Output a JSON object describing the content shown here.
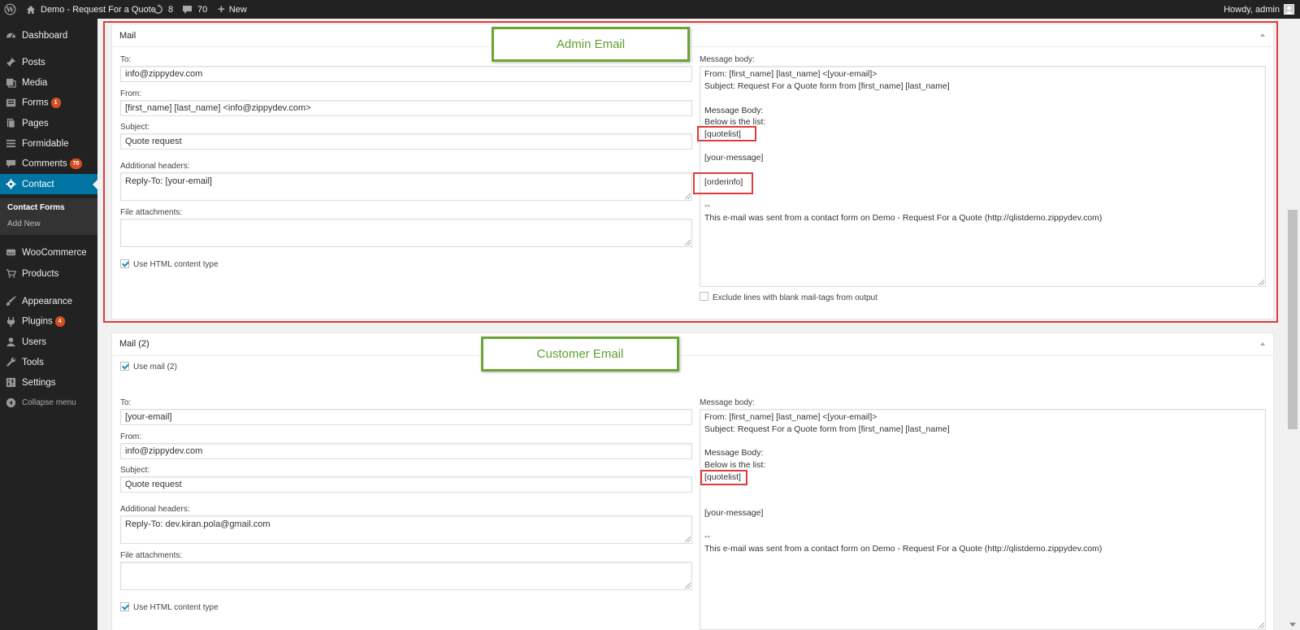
{
  "admin_bar": {
    "site_name": "Demo - Request For a Quote",
    "updates_count": "8",
    "comments_count": "70",
    "new_label": "New",
    "greeting": "Howdy, admin"
  },
  "menu": {
    "items": [
      {
        "label": "Dashboard",
        "icon": "dashboard-icon"
      },
      {
        "label": "Posts",
        "icon": "pin-icon"
      },
      {
        "label": "Media",
        "icon": "media-icon"
      },
      {
        "label": "Forms",
        "icon": "forms-icon",
        "badge": "1"
      },
      {
        "label": "Pages",
        "icon": "pages-icon"
      },
      {
        "label": "Formidable",
        "icon": "formidable-icon"
      },
      {
        "label": "Comments",
        "icon": "comment-icon",
        "badge": "70"
      },
      {
        "label": "Contact",
        "icon": "gear-icon"
      },
      {
        "label": "WooCommerce",
        "icon": "woocommerce-icon"
      },
      {
        "label": "Products",
        "icon": "cart-icon"
      },
      {
        "label": "Appearance",
        "icon": "brush-icon"
      },
      {
        "label": "Plugins",
        "icon": "plug-icon",
        "badge": "4"
      },
      {
        "label": "Users",
        "icon": "user-icon"
      },
      {
        "label": "Tools",
        "icon": "wrench-icon"
      },
      {
        "label": "Settings",
        "icon": "settings-icon"
      }
    ],
    "submenu": [
      "Contact Forms",
      "Add New"
    ],
    "collapse_label": "Collapse menu"
  },
  "annotations": {
    "admin_email": "Admin Email",
    "customer_email": "Customer Email"
  },
  "mail1": {
    "title": "Mail",
    "to_label": "To:",
    "to_value": "info@zippydev.com",
    "from_label": "From:",
    "from_value": "[first_name] [last_name] <info@zippydev.com>",
    "subject_label": "Subject:",
    "subject_value": "Quote request",
    "headers_label": "Additional headers:",
    "headers_value": "Reply-To: [your-email]",
    "attachments_label": "File attachments:",
    "html_label": "Use HTML content type",
    "html_checked": true,
    "body_label": "Message body:",
    "body_lines": [
      "From: [first_name] [last_name] <[your-email]>",
      "Subject: Request For a Quote form from [first_name] [last_name]",
      "",
      "Message Body:",
      "Below is the list:",
      "[quotelist]",
      "",
      "[your-message]",
      "",
      "[orderinfo]",
      "",
      "--",
      "This e-mail was sent from a contact form on Demo - Request For a Quote (http://qlistdemo.zippydev.com)"
    ],
    "exclude_label": "Exclude lines with blank mail-tags from output"
  },
  "mail2": {
    "title": "Mail (2)",
    "use_label": "Use mail (2)",
    "use_checked": true,
    "to_label": "To:",
    "to_value": "[your-email]",
    "from_label": "From:",
    "from_value": "info@zippydev.com",
    "subject_label": "Subject:",
    "subject_value": "Quote request",
    "headers_label": "Additional headers:",
    "headers_value": "Reply-To: dev.kiran.pola@gmail.com",
    "attachments_label": "File attachments:",
    "html_label": "Use HTML content type",
    "html_checked": true,
    "body_label": "Message body:",
    "body_lines": [
      "From: [first_name] [last_name] <[your-email]>",
      "Subject: Request For a Quote form from [first_name] [last_name]",
      "",
      "Message Body:",
      "Below is the list:",
      "[quotelist]",
      "",
      "",
      "[your-message]",
      "",
      "",
      "--",
      "This e-mail was sent from a contact form on Demo - Request For a Quote (http://qlistdemo.zippydev.com)"
    ]
  },
  "colors": {
    "admin_bar": "#222222",
    "menu_active": "#0074a2",
    "badge": "#d54e21",
    "highlight_red": "#dd3c3c",
    "annotation_green": "#6aa535"
  }
}
